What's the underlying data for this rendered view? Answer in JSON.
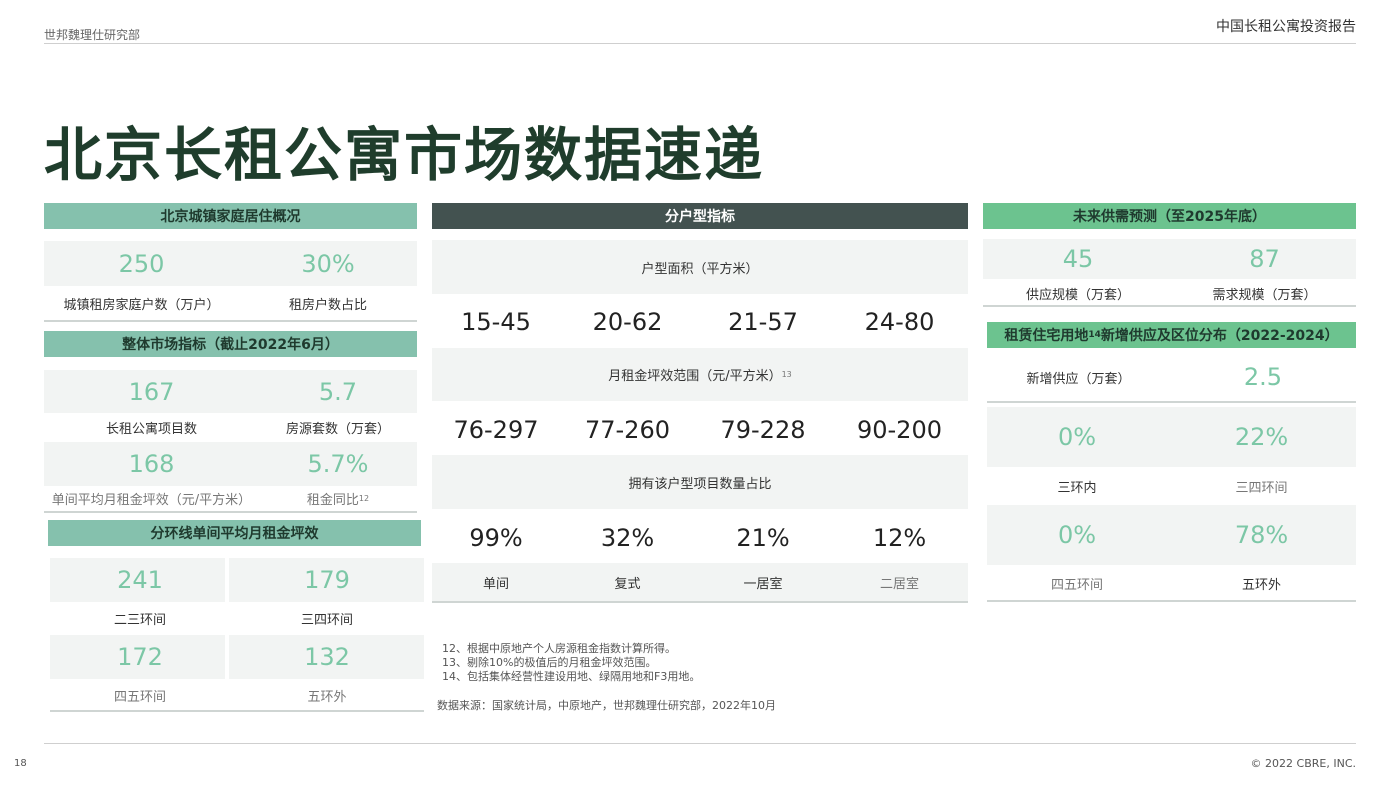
{
  "header": {
    "left": "世邦魏理仕研究部",
    "right": "中国长租公寓投资报告"
  },
  "title": "北京长租公寓市场数据速递",
  "household": {
    "header": "北京城镇家庭居住概况",
    "v1": "250",
    "l1": "城镇租房家庭户数（万户）",
    "v2": "30%",
    "l2": "租房户数占比"
  },
  "market": {
    "header": "整体市场指标（截止2022年6月）",
    "v1": "167",
    "l1": "长租公寓项目数",
    "v2": "5.7",
    "l2": "房源套数（万套）",
    "v3": "168",
    "l3": "单间平均月租金坪效（元/平方米）",
    "v4": "5.7%",
    "l4": "租金同比",
    "l4_sup": "12"
  },
  "ring": {
    "header": "分环线单间平均月租金坪效",
    "v1": "241",
    "l1": "二三环间",
    "v2": "179",
    "l2": "三四环间",
    "v3": "172",
    "l3": "四五环间",
    "v4": "132",
    "l4": "五环外"
  },
  "unit": {
    "header": "分户型指标",
    "area_label": "户型面积（平方米）",
    "area": [
      "15-45",
      "20-62",
      "21-57",
      "24-80"
    ],
    "rent_label": "月租金坪效范围（元/平方米）",
    "rent_sup": "13",
    "rent": [
      "76-297",
      "77-260",
      "79-228",
      "90-200"
    ],
    "share_label": "拥有该户型项目数量占比",
    "share": [
      "99%",
      "32%",
      "21%",
      "12%"
    ],
    "types": [
      "单间",
      "复式",
      "一居室",
      "二居室"
    ]
  },
  "forecast": {
    "header": "未来供需预测（至2025年底）",
    "v1": "45",
    "l1": "供应规模（万套）",
    "v2": "87",
    "l2": "需求规模（万套）"
  },
  "land": {
    "header_a": "租赁住宅用地",
    "header_sup": "14",
    "header_b": "新增供应及区位分布（2022-2024）",
    "new_label": "新增供应（万套）",
    "new_value": "2.5",
    "v1": "0%",
    "l1": "三环内",
    "v2": "22%",
    "l2": "三四环间",
    "v3": "0%",
    "l3": "四五环间",
    "v4": "78%",
    "l4": "五环外"
  },
  "notes": [
    "12、根据中原地产个人房源租金指数计算所得。",
    "13、剔除10%的极值后的月租金坪效范围。",
    "14、包括集体经营性建设用地、绿隔用地和F3用地。"
  ],
  "source": "数据来源：国家统计局，中原地产，世邦魏理仕研究部，2022年10月",
  "footer": {
    "page": "18",
    "copyright": "© 2022 CBRE, INC."
  },
  "colors": {
    "title": "#1f3d2c",
    "accent_value": "#7cc7a6",
    "teal_bar": "#85c1ad",
    "green_bar": "#6cc38f",
    "dark_bar": "#435250"
  }
}
